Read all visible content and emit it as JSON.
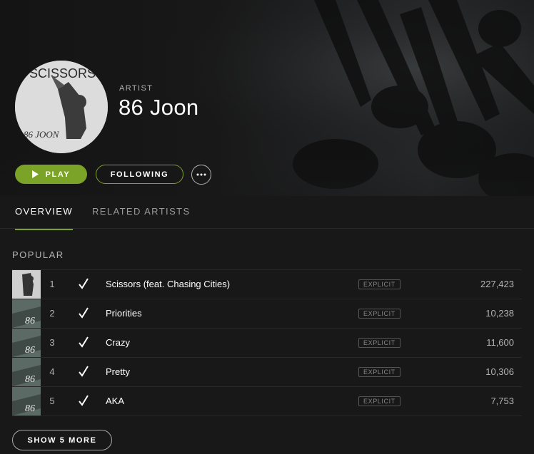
{
  "artist": {
    "label": "ARTIST",
    "name": "86 Joon",
    "avatar_text": "SCISSORS",
    "avatar_caption": "86 JOON"
  },
  "actions": {
    "play_label": "PLAY",
    "follow_label": "FOLLOWING",
    "more_icon": "ellipsis-icon"
  },
  "tabs": [
    {
      "label": "OVERVIEW",
      "active": true
    },
    {
      "label": "RELATED ARTISTS",
      "active": false
    }
  ],
  "popular": {
    "title": "POPULAR",
    "tracks": [
      {
        "rank": "1",
        "title": "Scissors (feat. Chasing Cities)",
        "explicit": "EXPLICIT",
        "plays": "227,423",
        "saved": true
      },
      {
        "rank": "2",
        "title": "Priorities",
        "explicit": "EXPLICIT",
        "plays": "10,238",
        "saved": true
      },
      {
        "rank": "3",
        "title": "Crazy",
        "explicit": "EXPLICIT",
        "plays": "11,600",
        "saved": true
      },
      {
        "rank": "4",
        "title": "Pretty",
        "explicit": "EXPLICIT",
        "plays": "10,306",
        "saved": true
      },
      {
        "rank": "5",
        "title": "AKA",
        "explicit": "EXPLICIT",
        "plays": "7,753",
        "saved": true
      }
    ],
    "show_more_label": "SHOW 5 MORE"
  },
  "colors": {
    "accent": "#7aa327",
    "background": "#181818",
    "text_muted": "#b3b3b3"
  }
}
